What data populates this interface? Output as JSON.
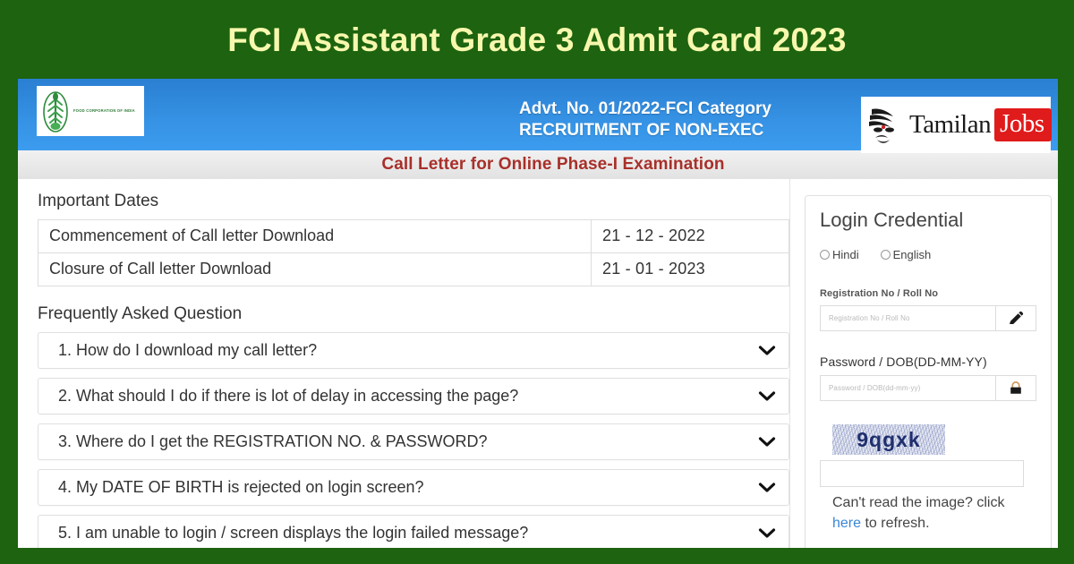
{
  "page": {
    "title": "FCI Assistant Grade 3 Admit Card 2023",
    "title_color": "#f7f8ad",
    "background_color": "#1d6310"
  },
  "header": {
    "logo_caption": "FOOD CORPORATION OF INDIA",
    "advt_line1": "Advt. No. 01/2022-FCI Category",
    "advt_line2": "RECRUITMENT OF NON-EXEC",
    "banner_color": "#3591e3",
    "watermark": {
      "brand_first": "Tamilan",
      "brand_second": "Jobs",
      "brand_second_bg": "#e01b1b"
    },
    "subtitle": "Call Letter for Online Phase-I Examination",
    "subtitle_color": "#a8302a"
  },
  "important_dates": {
    "heading": "Important Dates",
    "rows": [
      {
        "label": "Commencement of Call letter Download",
        "value": "21 - 12 - 2022"
      },
      {
        "label": "Closure of Call letter Download",
        "value": "21 - 01 - 2023"
      }
    ]
  },
  "faq": {
    "heading": "Frequently Asked Question",
    "items": [
      {
        "text": "1. How do I download my call letter?"
      },
      {
        "text": "2. What should I do if there is lot of delay in accessing the page?"
      },
      {
        "text": "3. Where do I get the REGISTRATION NO. & PASSWORD?"
      },
      {
        "text": "4. My DATE OF BIRTH is rejected on login screen?"
      },
      {
        "text": "5. I am unable to login / screen displays the login failed message?"
      }
    ],
    "expand_icon": "chevron-down-icon"
  },
  "login": {
    "title": "Login Credential",
    "languages": [
      {
        "label": "Hindi",
        "selected": false
      },
      {
        "label": "English",
        "selected": false
      }
    ],
    "registration": {
      "label": "Registration No / Roll No",
      "placeholder": "Registration No / Roll No",
      "value": "",
      "icon": "pencil-icon"
    },
    "password": {
      "label": "Password / DOB(DD-MM-YY)",
      "placeholder": "Password / DOB(dd-mm-yy)",
      "value": "",
      "icon": "lock-icon"
    },
    "captcha": {
      "text": "9qgxk",
      "value": "",
      "note_before": "Can't read the image? click ",
      "note_link": "here",
      "note_after": " to refresh.",
      "link_color": "#3a86d8"
    }
  }
}
